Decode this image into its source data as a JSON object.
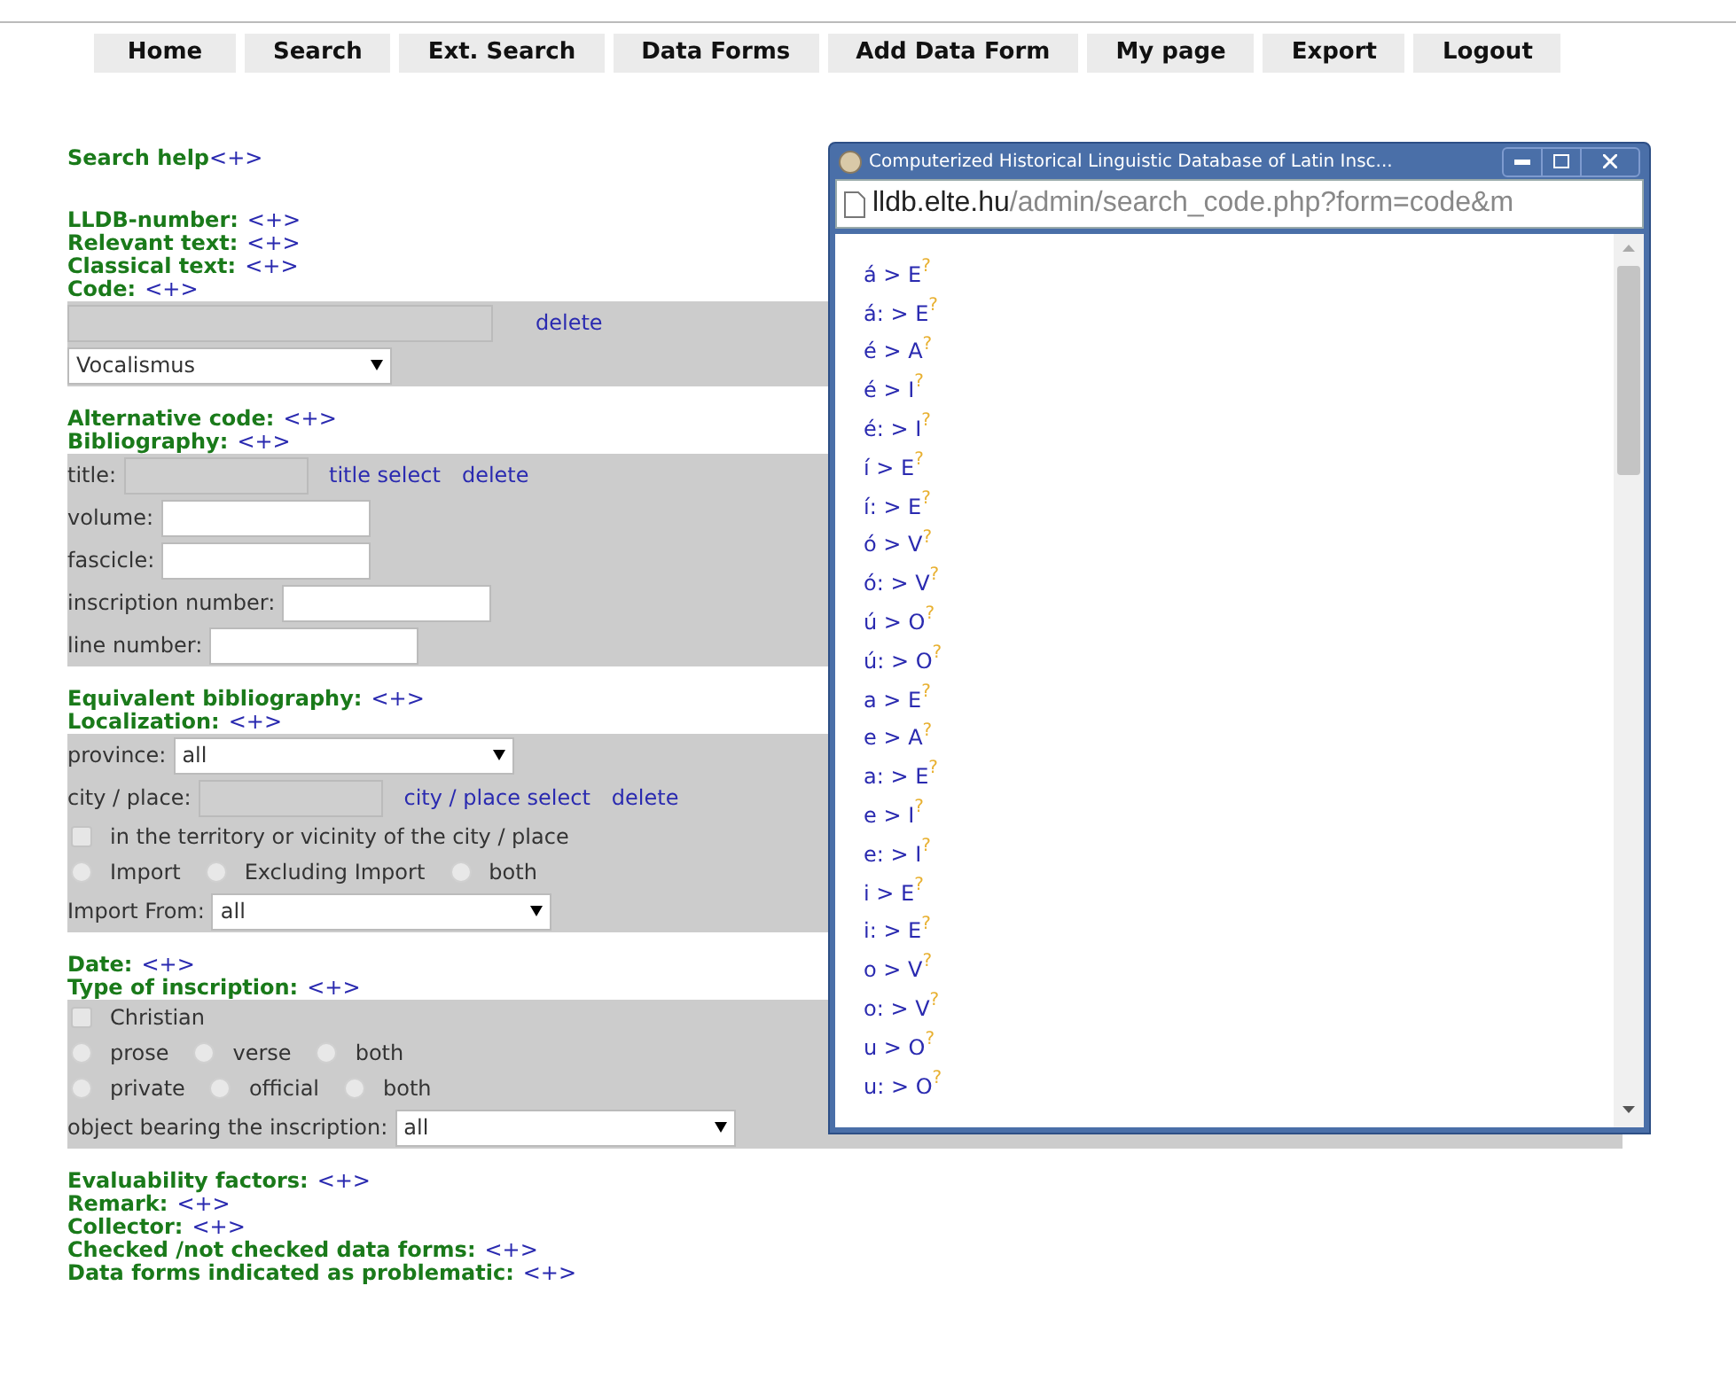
{
  "nav": [
    "Home",
    "Search",
    "Ext. Search",
    "Data Forms",
    "Add Data Form",
    "My page",
    "Export",
    "Logout"
  ],
  "blocks": [
    {
      "kind": "help",
      "label": "Search help",
      "toggle": "<+>"
    },
    {
      "kind": "headings",
      "items": [
        {
          "label": "LLDB-number:",
          "toggle": "<+>"
        },
        {
          "label": "Relevant text:",
          "toggle": "<+>"
        },
        {
          "label": "Classical text:",
          "toggle": "<+>"
        },
        {
          "label": "Code:",
          "toggle": "<+>"
        }
      ]
    },
    {
      "kind": "panel",
      "rows": [
        {
          "kind": "input",
          "disabled": true,
          "links": [
            "delete"
          ]
        },
        {
          "kind": "select",
          "value": "Vocalismus"
        }
      ]
    },
    {
      "kind": "headings",
      "items": [
        {
          "label": "Alternative code:",
          "toggle": "<+>"
        },
        {
          "label": "Bibliography:",
          "toggle": "<+>"
        }
      ]
    },
    {
      "kind": "panel",
      "rows": [
        {
          "kind": "input",
          "label": "title:",
          "disabled": true,
          "links": [
            "title select",
            "delete"
          ]
        },
        {
          "kind": "input",
          "label": "volume:",
          "disabled": false
        },
        {
          "kind": "input",
          "label": "fascicle:",
          "disabled": false
        },
        {
          "kind": "input",
          "label": "inscription number:",
          "disabled": false
        },
        {
          "kind": "input",
          "label": "line number:",
          "disabled": false
        }
      ]
    },
    {
      "kind": "headings",
      "items": [
        {
          "label": "Equivalent bibliography:",
          "toggle": "<+>"
        },
        {
          "label": "Localization:",
          "toggle": "<+>"
        }
      ]
    },
    {
      "kind": "panel",
      "rows": [
        {
          "kind": "select",
          "label": "province:",
          "value": "all"
        },
        {
          "kind": "input",
          "label": "city / place:",
          "disabled": true,
          "links": [
            "city / place select",
            "delete"
          ]
        },
        {
          "kind": "checkbox",
          "label": "in the territory or vicinity of the city / place",
          "checked": false
        },
        {
          "kind": "radios",
          "options": [
            {
              "label": "Import",
              "selected": false
            },
            {
              "label": "Excluding Import",
              "selected": false
            },
            {
              "label": "both",
              "selected": false
            }
          ]
        },
        {
          "kind": "select",
          "label": "Import From:",
          "value": "all"
        }
      ]
    },
    {
      "kind": "headings",
      "items": [
        {
          "label": "Date:",
          "toggle": "<+>"
        },
        {
          "label": "Type of inscription:",
          "toggle": "<+>"
        }
      ]
    },
    {
      "kind": "panel",
      "rows": [
        {
          "kind": "checkbox",
          "label": "Christian",
          "checked": false
        },
        {
          "kind": "radios",
          "options": [
            {
              "label": "prose",
              "selected": false
            },
            {
              "label": "verse",
              "selected": false
            },
            {
              "label": "both",
              "selected": false
            }
          ]
        },
        {
          "kind": "radios",
          "options": [
            {
              "label": "private",
              "selected": false
            },
            {
              "label": "official",
              "selected": false
            },
            {
              "label": "both",
              "selected": false
            }
          ]
        },
        {
          "kind": "select",
          "label": "object bearing the inscription:",
          "value": "all"
        }
      ]
    },
    {
      "kind": "headings",
      "items": [
        {
          "label": "Evaluability factors:",
          "toggle": "<+>"
        },
        {
          "label": "Remark:",
          "toggle": "<+>"
        },
        {
          "label": "Collector:",
          "toggle": "<+>"
        },
        {
          "label": "Checked /not checked data forms:",
          "toggle": "<+>"
        },
        {
          "label": "Data forms indicated as problematic:",
          "toggle": "<+>"
        }
      ]
    }
  ],
  "popup": {
    "title": "Computerized Historical Linguistic Database of Latin Insc...",
    "url_host": "lldb.elte.hu",
    "url_path": "/admin/search_code.php?form=code&m",
    "codes": [
      {
        "code": "á > E",
        "help": "?"
      },
      {
        "code": "á: > E",
        "help": "?"
      },
      {
        "code": "é > A",
        "help": "?"
      },
      {
        "code": "é > I",
        "help": "?"
      },
      {
        "code": "é: > I",
        "help": "?"
      },
      {
        "code": "í > E",
        "help": "?"
      },
      {
        "code": "í: > E",
        "help": "?"
      },
      {
        "code": "ó > V",
        "help": "?"
      },
      {
        "code": "ó: > V",
        "help": "?"
      },
      {
        "code": "ú > O",
        "help": "?"
      },
      {
        "code": "ú: > O",
        "help": "?"
      },
      {
        "code": "a > E",
        "help": "?"
      },
      {
        "code": "e > A",
        "help": "?"
      },
      {
        "code": "a: > E",
        "help": "?"
      },
      {
        "code": "e > I",
        "help": "?"
      },
      {
        "code": "e: > I",
        "help": "?"
      },
      {
        "code": "i > E",
        "help": "?"
      },
      {
        "code": "i: > E",
        "help": "?"
      },
      {
        "code": "o > V",
        "help": "?"
      },
      {
        "code": "o: > V",
        "help": "?"
      },
      {
        "code": "u > O",
        "help": "?"
      },
      {
        "code": "u: > O",
        "help": "?"
      }
    ]
  }
}
